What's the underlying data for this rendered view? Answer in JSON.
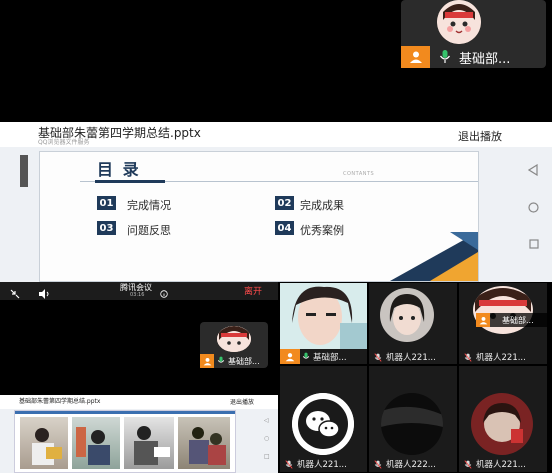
{
  "top_card": {
    "name": "基础部..."
  },
  "presentation": {
    "file_title": "基础部朱蕾第四学期总结.pptx",
    "subtitle": "QQ浏览器文件服务",
    "exit_label": "退出播放",
    "slide": {
      "heading": "目  录",
      "contents_label": "CONTANTS",
      "items": [
        {
          "num": "01",
          "label": "完成情况"
        },
        {
          "num": "02",
          "label": "完成成果"
        },
        {
          "num": "03",
          "label": "问题反思"
        },
        {
          "num": "04",
          "label": "优秀案例"
        }
      ]
    }
  },
  "meeting_toolbar": {
    "title": "腾讯会议",
    "time": "03:16",
    "leave_label": "离开"
  },
  "small_card": {
    "name": "基础部..."
  },
  "mini_presentation": {
    "file_title": "基础部朱蕾第四学期总结.pptx",
    "exit_label": "退出播放"
  },
  "grid_tiles": [
    {
      "label": "基础部..."
    },
    {
      "label": "机器人221..."
    },
    {
      "label": "机器人221..."
    },
    {
      "label": "机器人221..."
    },
    {
      "label": "机器人222..."
    },
    {
      "label": "机器人221..."
    }
  ],
  "grid_overlay_label": "基础部...",
  "colors": {
    "accent_orange": "#f28a1e",
    "mic_green": "#35c16b",
    "navy": "#1f3a5a",
    "leave_red": "#ff4b4b"
  }
}
